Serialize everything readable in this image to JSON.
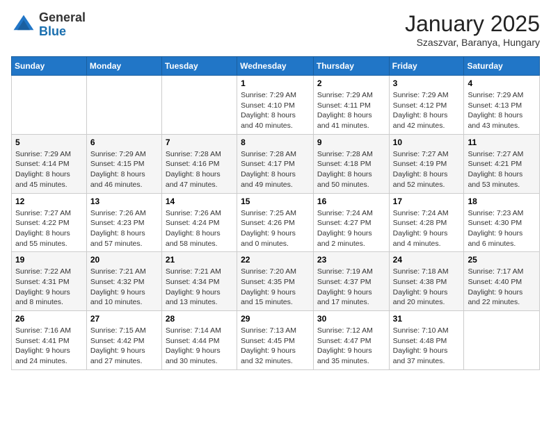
{
  "header": {
    "logo_general": "General",
    "logo_blue": "Blue",
    "month_title": "January 2025",
    "subtitle": "Szaszvar, Baranya, Hungary"
  },
  "weekdays": [
    "Sunday",
    "Monday",
    "Tuesday",
    "Wednesday",
    "Thursday",
    "Friday",
    "Saturday"
  ],
  "weeks": [
    [
      {
        "day": "",
        "detail": ""
      },
      {
        "day": "",
        "detail": ""
      },
      {
        "day": "",
        "detail": ""
      },
      {
        "day": "1",
        "detail": "Sunrise: 7:29 AM\nSunset: 4:10 PM\nDaylight: 8 hours\nand 40 minutes."
      },
      {
        "day": "2",
        "detail": "Sunrise: 7:29 AM\nSunset: 4:11 PM\nDaylight: 8 hours\nand 41 minutes."
      },
      {
        "day": "3",
        "detail": "Sunrise: 7:29 AM\nSunset: 4:12 PM\nDaylight: 8 hours\nand 42 minutes."
      },
      {
        "day": "4",
        "detail": "Sunrise: 7:29 AM\nSunset: 4:13 PM\nDaylight: 8 hours\nand 43 minutes."
      }
    ],
    [
      {
        "day": "5",
        "detail": "Sunrise: 7:29 AM\nSunset: 4:14 PM\nDaylight: 8 hours\nand 45 minutes."
      },
      {
        "day": "6",
        "detail": "Sunrise: 7:29 AM\nSunset: 4:15 PM\nDaylight: 8 hours\nand 46 minutes."
      },
      {
        "day": "7",
        "detail": "Sunrise: 7:28 AM\nSunset: 4:16 PM\nDaylight: 8 hours\nand 47 minutes."
      },
      {
        "day": "8",
        "detail": "Sunrise: 7:28 AM\nSunset: 4:17 PM\nDaylight: 8 hours\nand 49 minutes."
      },
      {
        "day": "9",
        "detail": "Sunrise: 7:28 AM\nSunset: 4:18 PM\nDaylight: 8 hours\nand 50 minutes."
      },
      {
        "day": "10",
        "detail": "Sunrise: 7:27 AM\nSunset: 4:19 PM\nDaylight: 8 hours\nand 52 minutes."
      },
      {
        "day": "11",
        "detail": "Sunrise: 7:27 AM\nSunset: 4:21 PM\nDaylight: 8 hours\nand 53 minutes."
      }
    ],
    [
      {
        "day": "12",
        "detail": "Sunrise: 7:27 AM\nSunset: 4:22 PM\nDaylight: 8 hours\nand 55 minutes."
      },
      {
        "day": "13",
        "detail": "Sunrise: 7:26 AM\nSunset: 4:23 PM\nDaylight: 8 hours\nand 57 minutes."
      },
      {
        "day": "14",
        "detail": "Sunrise: 7:26 AM\nSunset: 4:24 PM\nDaylight: 8 hours\nand 58 minutes."
      },
      {
        "day": "15",
        "detail": "Sunrise: 7:25 AM\nSunset: 4:26 PM\nDaylight: 9 hours\nand 0 minutes."
      },
      {
        "day": "16",
        "detail": "Sunrise: 7:24 AM\nSunset: 4:27 PM\nDaylight: 9 hours\nand 2 minutes."
      },
      {
        "day": "17",
        "detail": "Sunrise: 7:24 AM\nSunset: 4:28 PM\nDaylight: 9 hours\nand 4 minutes."
      },
      {
        "day": "18",
        "detail": "Sunrise: 7:23 AM\nSunset: 4:30 PM\nDaylight: 9 hours\nand 6 minutes."
      }
    ],
    [
      {
        "day": "19",
        "detail": "Sunrise: 7:22 AM\nSunset: 4:31 PM\nDaylight: 9 hours\nand 8 minutes."
      },
      {
        "day": "20",
        "detail": "Sunrise: 7:21 AM\nSunset: 4:32 PM\nDaylight: 9 hours\nand 10 minutes."
      },
      {
        "day": "21",
        "detail": "Sunrise: 7:21 AM\nSunset: 4:34 PM\nDaylight: 9 hours\nand 13 minutes."
      },
      {
        "day": "22",
        "detail": "Sunrise: 7:20 AM\nSunset: 4:35 PM\nDaylight: 9 hours\nand 15 minutes."
      },
      {
        "day": "23",
        "detail": "Sunrise: 7:19 AM\nSunset: 4:37 PM\nDaylight: 9 hours\nand 17 minutes."
      },
      {
        "day": "24",
        "detail": "Sunrise: 7:18 AM\nSunset: 4:38 PM\nDaylight: 9 hours\nand 20 minutes."
      },
      {
        "day": "25",
        "detail": "Sunrise: 7:17 AM\nSunset: 4:40 PM\nDaylight: 9 hours\nand 22 minutes."
      }
    ],
    [
      {
        "day": "26",
        "detail": "Sunrise: 7:16 AM\nSunset: 4:41 PM\nDaylight: 9 hours\nand 24 minutes."
      },
      {
        "day": "27",
        "detail": "Sunrise: 7:15 AM\nSunset: 4:42 PM\nDaylight: 9 hours\nand 27 minutes."
      },
      {
        "day": "28",
        "detail": "Sunrise: 7:14 AM\nSunset: 4:44 PM\nDaylight: 9 hours\nand 30 minutes."
      },
      {
        "day": "29",
        "detail": "Sunrise: 7:13 AM\nSunset: 4:45 PM\nDaylight: 9 hours\nand 32 minutes."
      },
      {
        "day": "30",
        "detail": "Sunrise: 7:12 AM\nSunset: 4:47 PM\nDaylight: 9 hours\nand 35 minutes."
      },
      {
        "day": "31",
        "detail": "Sunrise: 7:10 AM\nSunset: 4:48 PM\nDaylight: 9 hours\nand 37 minutes."
      },
      {
        "day": "",
        "detail": ""
      }
    ]
  ]
}
